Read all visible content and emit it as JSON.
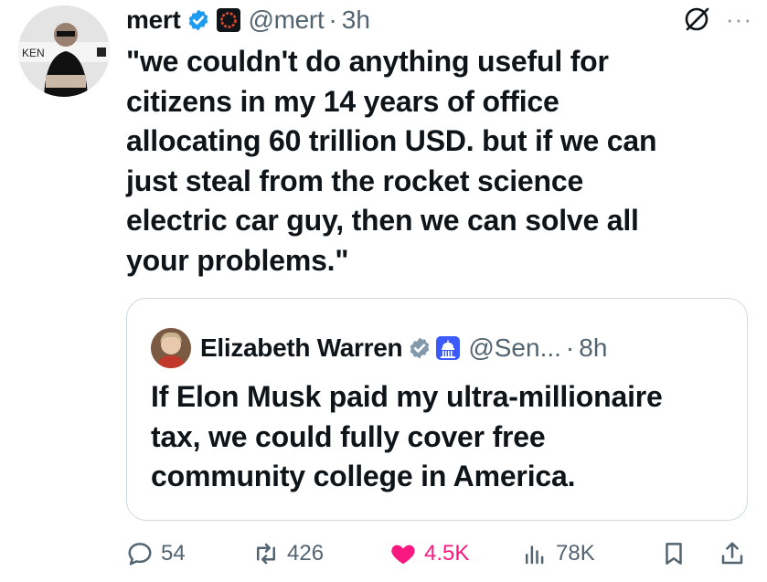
{
  "tweet": {
    "author_name": "mert",
    "handle": "@mert",
    "separator": "·",
    "time": "3h",
    "more": "···",
    "text": "\"we couldn't do anything useful for\ncitizens in my 14 years of office\nallocating 60 trillion USD. but if we can\njust steal from the rocket science\nelectric car guy, then we can solve all\nyour problems.\""
  },
  "quoted": {
    "author_name": "Elizabeth Warren",
    "handle": "@Sen...",
    "separator": "·",
    "time": "8h",
    "text": "If Elon Musk paid my ultra-millionaire\ntax, we could fully cover free\ncommunity college in America."
  },
  "actions": {
    "replies": "54",
    "reposts": "426",
    "likes": "4.5K",
    "views": "78K"
  },
  "colors": {
    "verified_blue": "#1d9bf0",
    "gov_badge_gray": "#829aab",
    "like_pink": "#f91880",
    "secondary_text": "#536471",
    "border": "#cfd9de"
  }
}
